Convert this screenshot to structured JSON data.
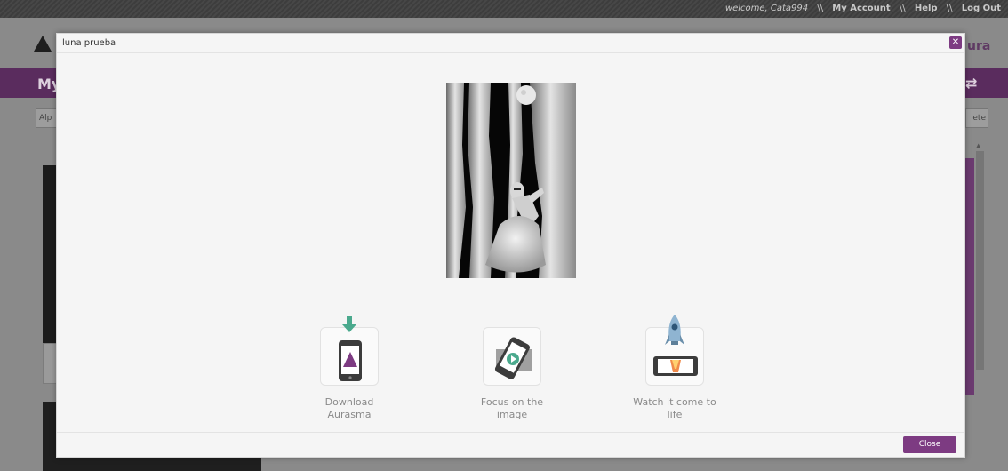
{
  "topbar": {
    "welcome": "welcome, Cata994",
    "separator": "\\\\",
    "my_account": "My Account",
    "help": "Help",
    "logout": "Log Out"
  },
  "background": {
    "brand_fragment": "ura",
    "title_fragment": "My",
    "filter_fragment": "Alp",
    "right_button_fragment": "ete"
  },
  "modal": {
    "title": "luna prueba",
    "close_button": "Close",
    "steps": [
      {
        "label_line1": "Download",
        "label_line2": "Aurasma",
        "icon": "download-phone-icon"
      },
      {
        "label_line1": "Focus on the",
        "label_line2": "image",
        "icon": "focus-phone-icon"
      },
      {
        "label_line1": "Watch it come to",
        "label_line2": "life",
        "icon": "rocket-phone-icon"
      }
    ]
  },
  "colors": {
    "accent_purple": "#7d3b82",
    "teal": "#4aa98d",
    "header_purple": "#5a2c5e"
  }
}
